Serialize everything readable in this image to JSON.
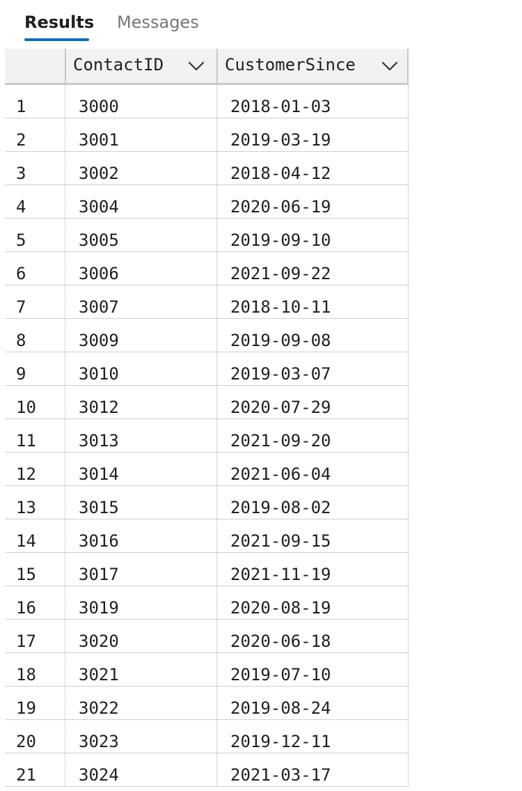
{
  "tabs": [
    {
      "label": "Results",
      "active": true
    },
    {
      "label": "Messages",
      "active": false
    }
  ],
  "colors": {
    "accent": "#0f6cbd",
    "header_bg": "#f2f2f2",
    "text": "#1f1f1f",
    "muted": "#767676"
  },
  "grid": {
    "columns": [
      {
        "label": "ContactID",
        "icon": "chevron-down-icon"
      },
      {
        "label": "CustomerSince",
        "icon": "chevron-down-icon"
      }
    ],
    "rows": [
      {
        "n": "1",
        "ContactID": "3000",
        "CustomerSince": "2018-01-03"
      },
      {
        "n": "2",
        "ContactID": "3001",
        "CustomerSince": "2019-03-19"
      },
      {
        "n": "3",
        "ContactID": "3002",
        "CustomerSince": "2018-04-12"
      },
      {
        "n": "4",
        "ContactID": "3004",
        "CustomerSince": "2020-06-19"
      },
      {
        "n": "5",
        "ContactID": "3005",
        "CustomerSince": "2019-09-10"
      },
      {
        "n": "6",
        "ContactID": "3006",
        "CustomerSince": "2021-09-22"
      },
      {
        "n": "7",
        "ContactID": "3007",
        "CustomerSince": "2018-10-11"
      },
      {
        "n": "8",
        "ContactID": "3009",
        "CustomerSince": "2019-09-08"
      },
      {
        "n": "9",
        "ContactID": "3010",
        "CustomerSince": "2019-03-07"
      },
      {
        "n": "10",
        "ContactID": "3012",
        "CustomerSince": "2020-07-29"
      },
      {
        "n": "11",
        "ContactID": "3013",
        "CustomerSince": "2021-09-20"
      },
      {
        "n": "12",
        "ContactID": "3014",
        "CustomerSince": "2021-06-04"
      },
      {
        "n": "13",
        "ContactID": "3015",
        "CustomerSince": "2019-08-02"
      },
      {
        "n": "14",
        "ContactID": "3016",
        "CustomerSince": "2021-09-15"
      },
      {
        "n": "15",
        "ContactID": "3017",
        "CustomerSince": "2021-11-19"
      },
      {
        "n": "16",
        "ContactID": "3019",
        "CustomerSince": "2020-08-19"
      },
      {
        "n": "17",
        "ContactID": "3020",
        "CustomerSince": "2020-06-18"
      },
      {
        "n": "18",
        "ContactID": "3021",
        "CustomerSince": "2019-07-10"
      },
      {
        "n": "19",
        "ContactID": "3022",
        "CustomerSince": "2019-08-24"
      },
      {
        "n": "20",
        "ContactID": "3023",
        "CustomerSince": "2019-12-11"
      },
      {
        "n": "21",
        "ContactID": "3024",
        "CustomerSince": "2021-03-17"
      }
    ]
  }
}
